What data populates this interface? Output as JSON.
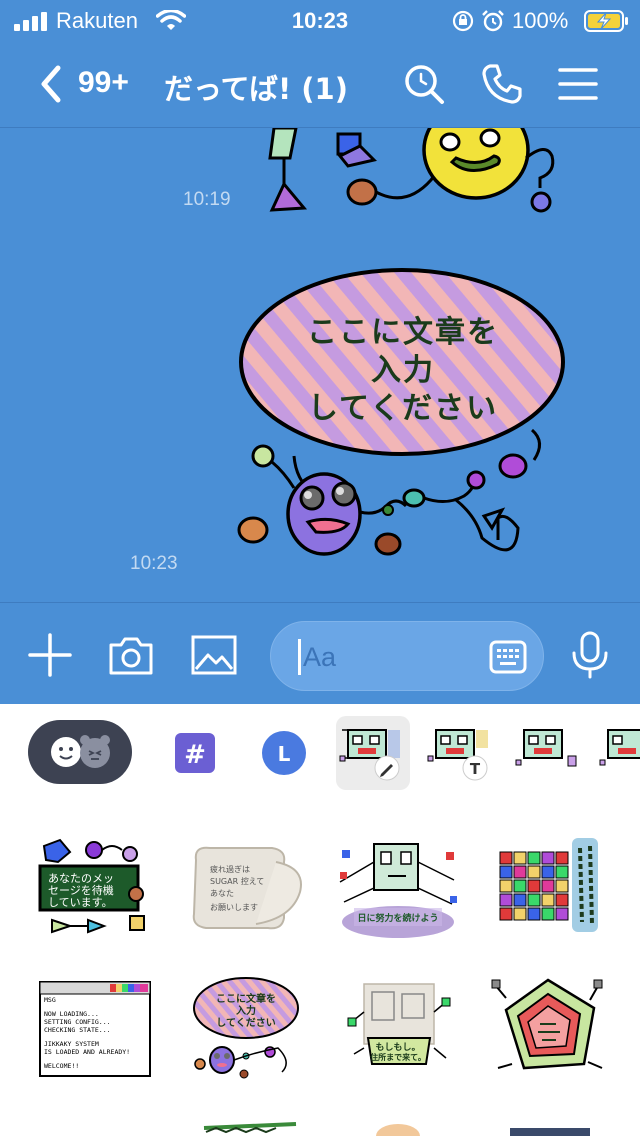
{
  "status_bar": {
    "carrier": "Rakuten",
    "time": "10:23",
    "battery_percent": "100%",
    "icons": [
      "signal-icon",
      "wifi-icon",
      "rotation-lock-icon",
      "alarm-icon",
      "battery-charging-icon"
    ]
  },
  "nav": {
    "back_icon": "chevron-left-icon",
    "unread_count": "99+",
    "chat_title": "だってば! (1)",
    "buttons": [
      "search-icon",
      "phone-icon",
      "menu-icon"
    ]
  },
  "messages": [
    {
      "type": "sticker",
      "time": "10:19"
    },
    {
      "type": "sticker",
      "time": "10:23",
      "text_lines": [
        "ここに文章を",
        "入力",
        "してください"
      ]
    }
  ],
  "input_bar": {
    "placeholder": "Aa",
    "buttons": [
      "plus-icon",
      "camera-icon",
      "image-icon",
      "keyboard-icon",
      "microphone-icon"
    ]
  },
  "keyboard_tabs": [
    {
      "name": "emoji-sticker-tab",
      "label": ""
    },
    {
      "name": "hashtag-tab",
      "label": "#"
    },
    {
      "name": "line-tab",
      "label": "L"
    },
    {
      "name": "custom-sticker-edit-tab",
      "label": ""
    },
    {
      "name": "custom-sticker-text-tab",
      "label": "T"
    },
    {
      "name": "custom-sticker-tab-3",
      "label": ""
    },
    {
      "name": "custom-sticker-tab-4",
      "label": ""
    }
  ],
  "sticker_grid": [
    {
      "name": "sticker-waiting-message",
      "lines": [
        "あなたのメッ",
        "セージを待機",
        "しています。"
      ]
    },
    {
      "name": "sticker-tired-note",
      "lines": [
        "疲れ過ぎは",
        "SUGAR 控えて",
        "あなた",
        "お願いします"
      ]
    },
    {
      "name": "sticker-effort-continue",
      "lines": [
        "日に努力を続けよう"
      ]
    },
    {
      "name": "sticker-colorful-grid",
      "lines": []
    },
    {
      "name": "sticker-system-loading",
      "lines": [
        "MSG",
        "NOW LOADING...",
        "SETTING CONFIG...",
        "CHECKING STATE...",
        "JIKKAKY SYSTEM",
        "IS LOADED AND ALREADY!",
        "WELCOME!!"
      ]
    },
    {
      "name": "sticker-enter-text",
      "lines": [
        "ここに文章を",
        "入力",
        "してください"
      ]
    },
    {
      "name": "sticker-moshimoshi",
      "lines": [
        "もしもし。",
        "住所まで来て。"
      ]
    },
    {
      "name": "sticker-pentagon",
      "lines": []
    }
  ],
  "colors": {
    "line_blue": "#4a8fd6",
    "input_field": "#6aa6e6",
    "pill_dark": "#3d4252",
    "hashtag_purple": "#6b5fd3",
    "line_tab_blue": "#4a7ae0"
  }
}
